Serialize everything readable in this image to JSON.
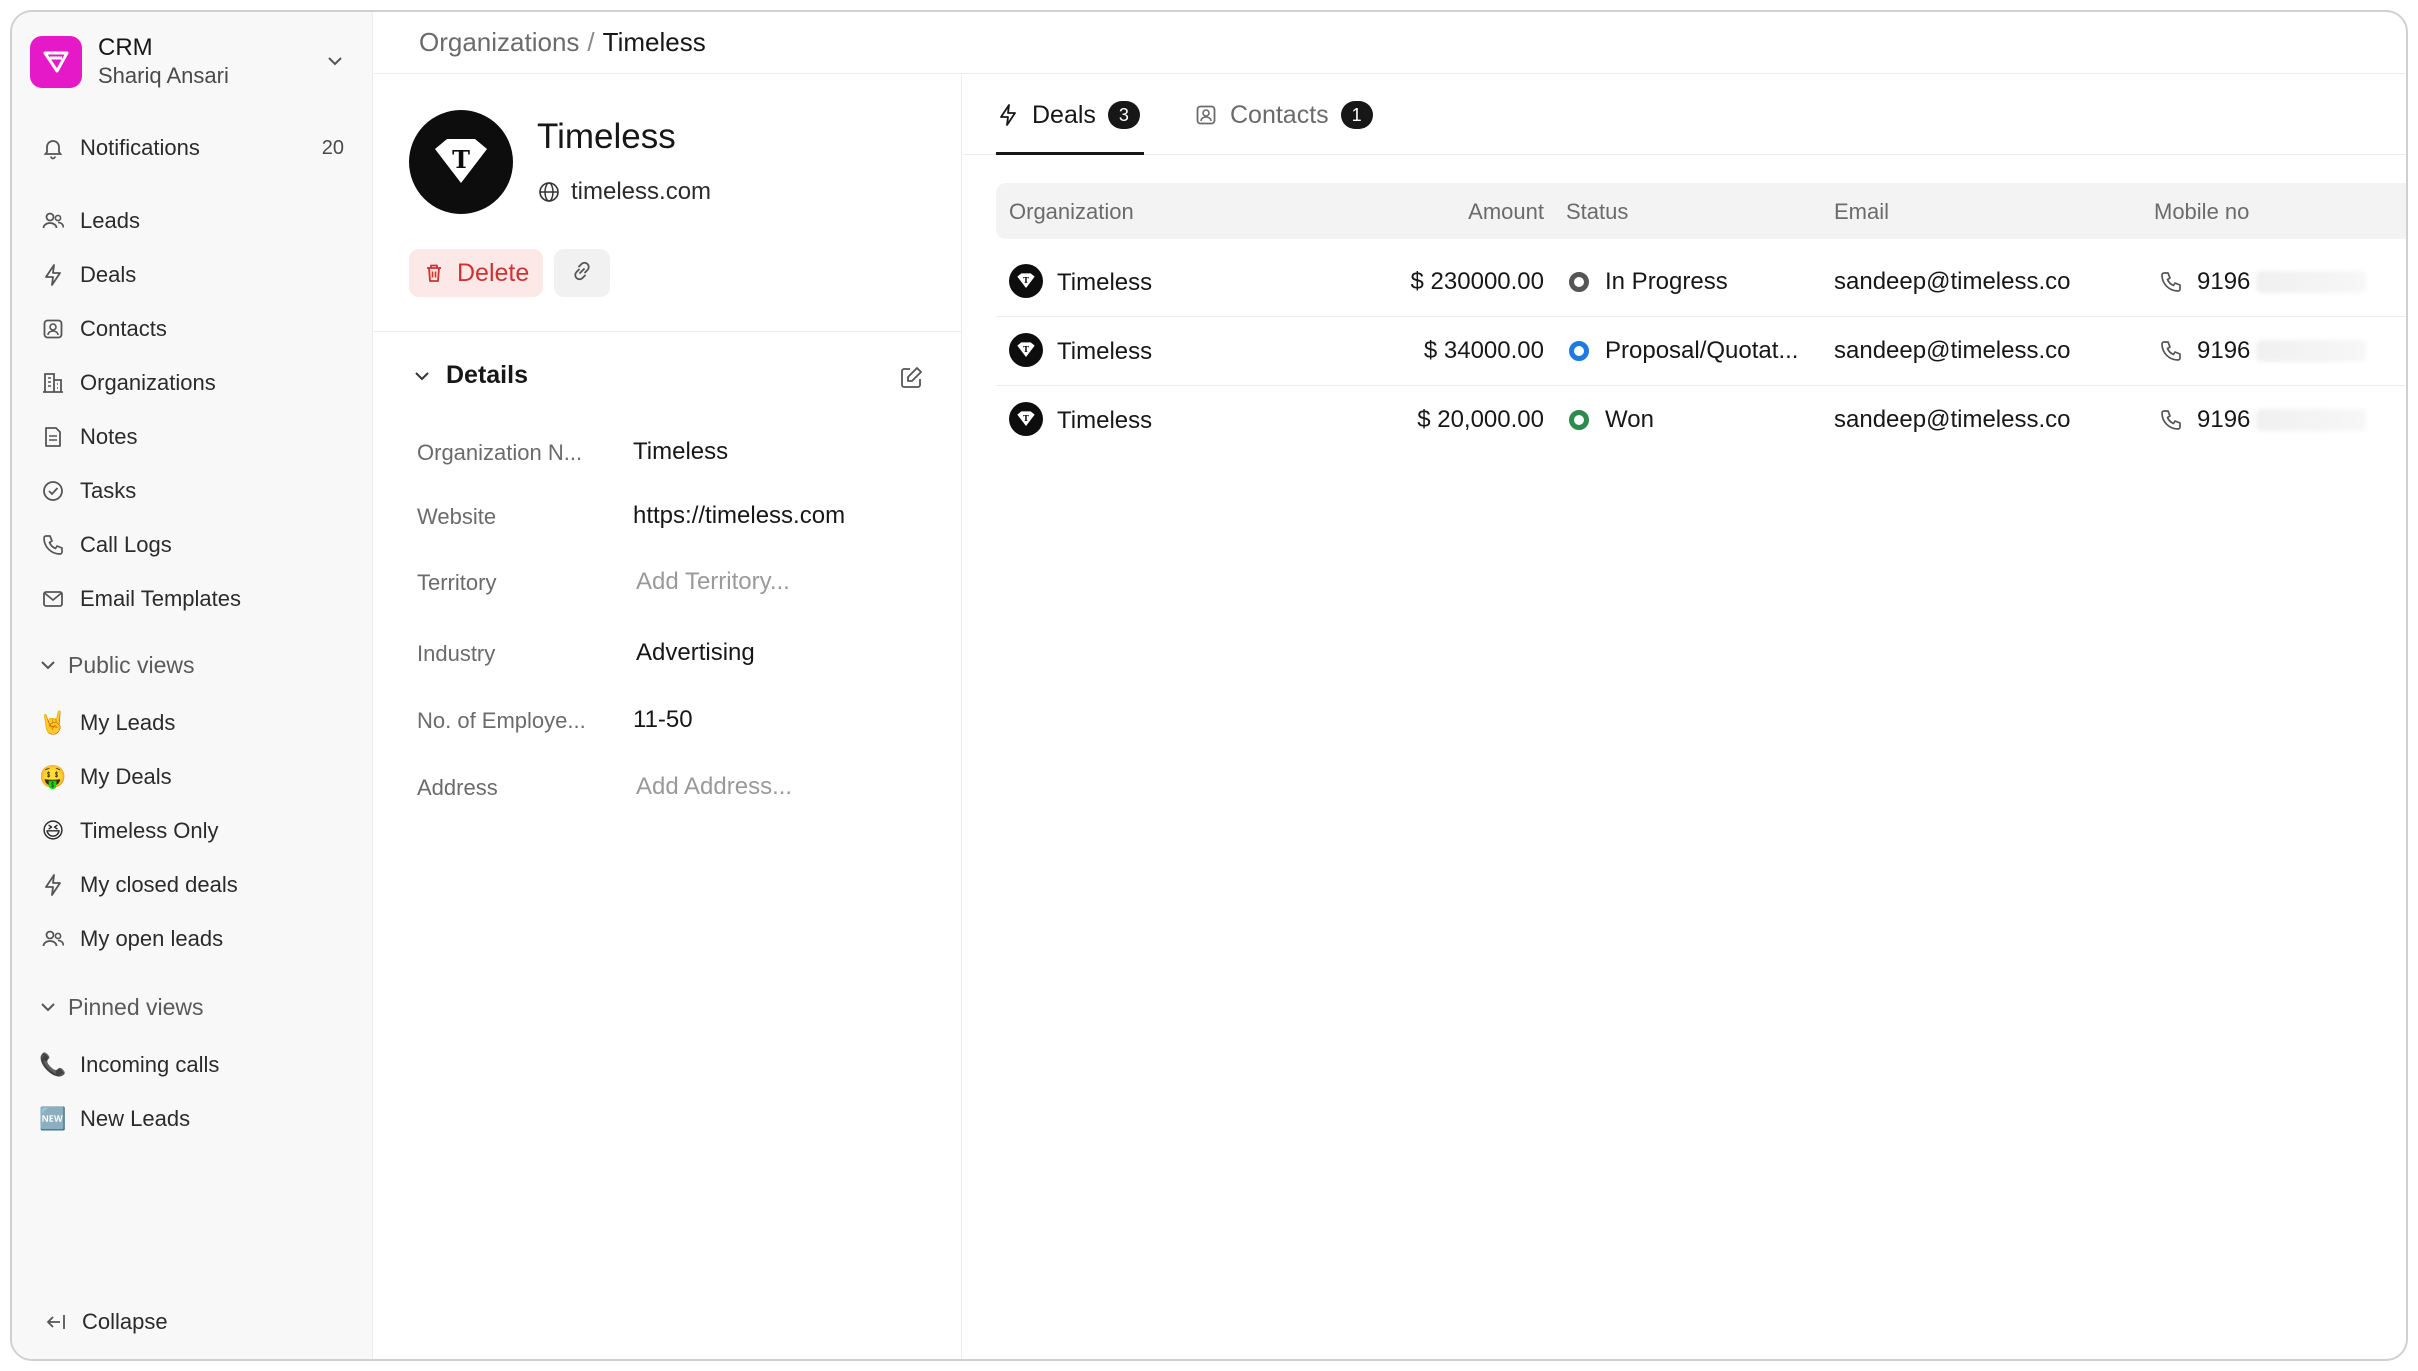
{
  "sidebar": {
    "brand": {
      "title": "CRM",
      "user": "Shariq Ansari",
      "color": "#e619c8"
    },
    "notifications": {
      "label": "Notifications",
      "count": "20"
    },
    "items": [
      {
        "label": "Leads",
        "icon": "users-icon"
      },
      {
        "label": "Deals",
        "icon": "lightning-icon"
      },
      {
        "label": "Contacts",
        "icon": "contact-card-icon"
      },
      {
        "label": "Organizations",
        "icon": "building-icon"
      },
      {
        "label": "Notes",
        "icon": "note-icon"
      },
      {
        "label": "Tasks",
        "icon": "check-circle-icon"
      },
      {
        "label": "Call Logs",
        "icon": "phone-icon"
      },
      {
        "label": "Email Templates",
        "icon": "mail-icon"
      }
    ],
    "public_views": {
      "title": "Public views",
      "items": [
        {
          "label": "My Leads",
          "emoji": "🤘"
        },
        {
          "label": "My Deals",
          "emoji": "🤑"
        },
        {
          "label": "Timeless Only",
          "emoji": "😆"
        },
        {
          "label": "My closed deals",
          "icon": "lightning-icon"
        },
        {
          "label": "My open leads",
          "icon": "users-icon"
        }
      ]
    },
    "pinned_views": {
      "title": "Pinned views",
      "items": [
        {
          "label": "Incoming calls",
          "emoji": "📞"
        },
        {
          "label": "New Leads",
          "emoji": "🆕"
        }
      ]
    },
    "collapse_label": "Collapse"
  },
  "breadcrumb": {
    "parent": "Organizations",
    "separator": "/",
    "current": "Timeless"
  },
  "organization": {
    "name": "Timeless",
    "website_short": "timeless.com",
    "delete_label": "Delete",
    "details_title": "Details",
    "fields": [
      {
        "label": "Organization N...",
        "value": "Timeless",
        "placeholder": false
      },
      {
        "label": "Website",
        "value": "https://timeless.com",
        "placeholder": false
      },
      {
        "label": "Territory",
        "value": "Add Territory...",
        "placeholder": true
      },
      {
        "label": "Industry",
        "value": "Advertising",
        "placeholder": false
      },
      {
        "label": "No. of Employe...",
        "value": "11-50",
        "placeholder": false
      },
      {
        "label": "Address",
        "value": "Add Address...",
        "placeholder": true
      }
    ]
  },
  "tabs": [
    {
      "label": "Deals",
      "count": "3",
      "active": true
    },
    {
      "label": "Contacts",
      "count": "1",
      "active": false
    }
  ],
  "table": {
    "columns": [
      "Organization",
      "Amount",
      "Status",
      "Email",
      "Mobile no"
    ],
    "rows": [
      {
        "organization": "Timeless",
        "amount": "$ 230000.00",
        "status": "In Progress",
        "status_color": "#555555",
        "email": "sandeep@timeless.co",
        "mobile": "9196"
      },
      {
        "organization": "Timeless",
        "amount": "$ 34000.00",
        "status": "Proposal/Quotat...",
        "status_color": "#1e7ae0",
        "email": "sandeep@timeless.co",
        "mobile": "9196"
      },
      {
        "organization": "Timeless",
        "amount": "$ 20,000.00",
        "status": "Won",
        "status_color": "#2e8b4e",
        "email": "sandeep@timeless.co",
        "mobile": "9196"
      }
    ]
  }
}
